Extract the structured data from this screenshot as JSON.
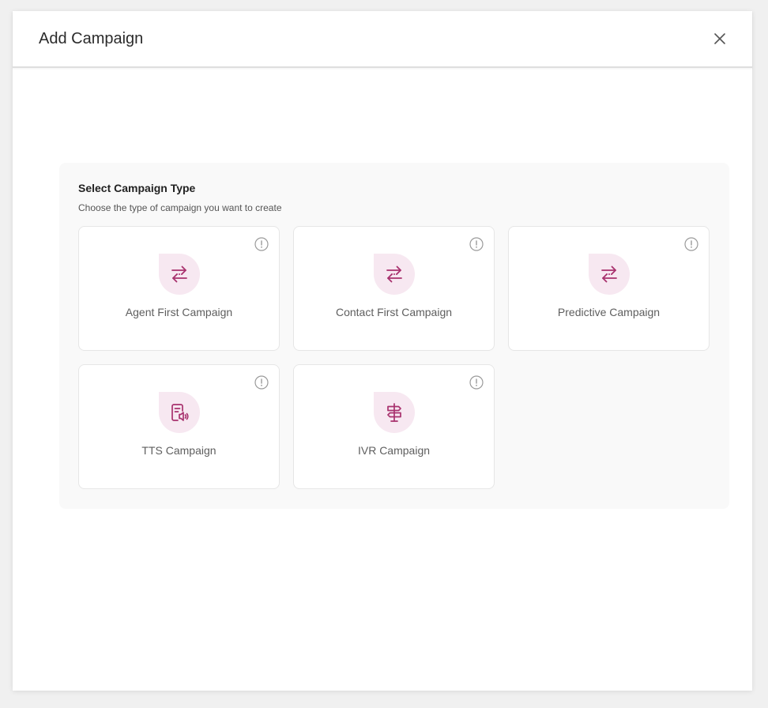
{
  "modal": {
    "title": "Add Campaign",
    "close_icon": "close-icon"
  },
  "panel": {
    "title": "Select Campaign Type",
    "subtitle": "Choose the type of campaign you want to create"
  },
  "cards": [
    {
      "label": "Agent First Campaign",
      "icon": "swap-arrows-icon"
    },
    {
      "label": "Contact First Campaign",
      "icon": "swap-arrows-icon"
    },
    {
      "label": "Predictive Campaign",
      "icon": "swap-arrows-icon"
    },
    {
      "label": "TTS Campaign",
      "icon": "document-speaker-icon"
    },
    {
      "label": "IVR Campaign",
      "icon": "signpost-icon"
    }
  ],
  "colors": {
    "accent": "#a8326e",
    "icon_bg": "#f7e8f1",
    "panel_bg": "#f9f9f9"
  }
}
